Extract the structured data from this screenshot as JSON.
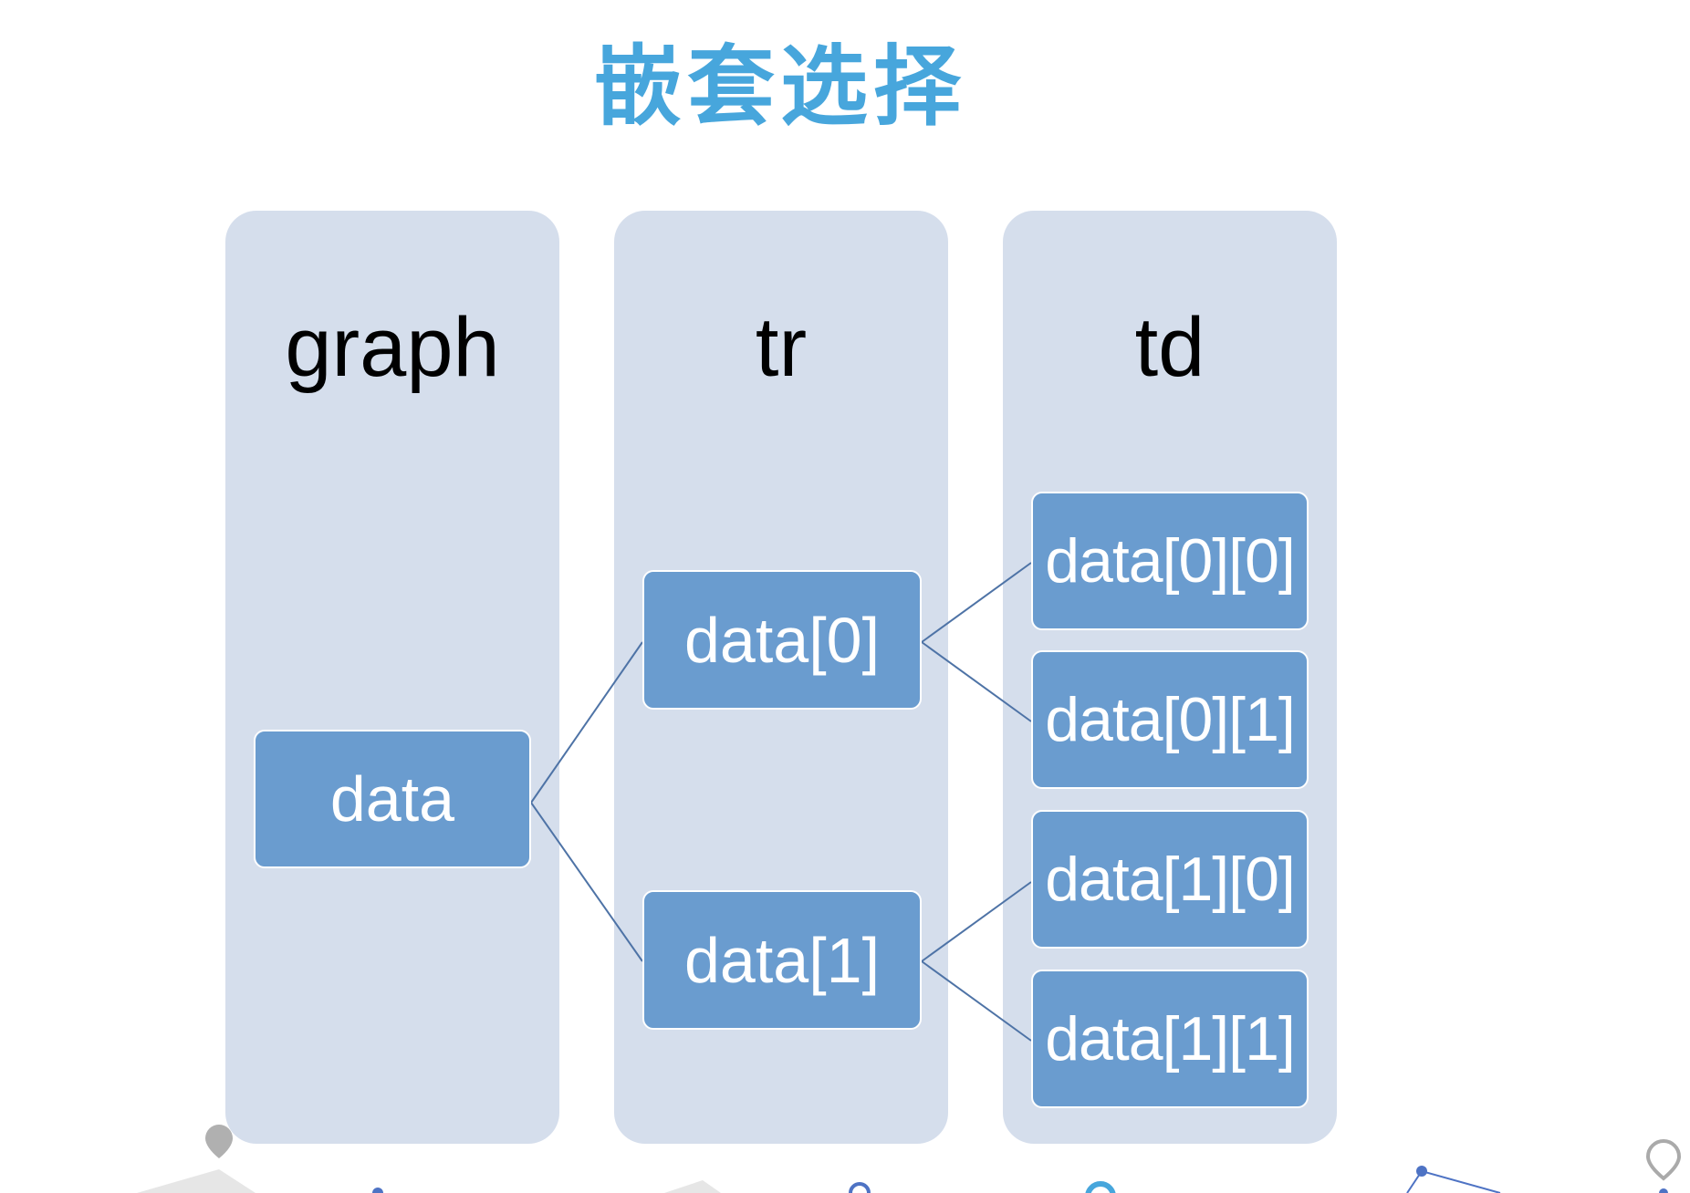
{
  "title": "嵌套选择",
  "colors": {
    "title": "#47a6dc",
    "column_background": "#d5deec",
    "node_fill": "#6a9ccf",
    "connector": "#4e73a6"
  },
  "columns": [
    {
      "label": "graph"
    },
    {
      "label": "tr"
    },
    {
      "label": "td"
    }
  ],
  "nodes": {
    "root": "data",
    "level1": [
      "data[0]",
      "data[1]"
    ],
    "level2": [
      "data[0][0]",
      "data[0][1]",
      "data[1][0]",
      "data[1][1]"
    ]
  },
  "edges": [
    [
      "data",
      "data[0]"
    ],
    [
      "data",
      "data[1]"
    ],
    [
      "data[0]",
      "data[0][0]"
    ],
    [
      "data[0]",
      "data[0][1]"
    ],
    [
      "data[1]",
      "data[1][0]"
    ],
    [
      "data[1]",
      "data[1][1]"
    ]
  ]
}
